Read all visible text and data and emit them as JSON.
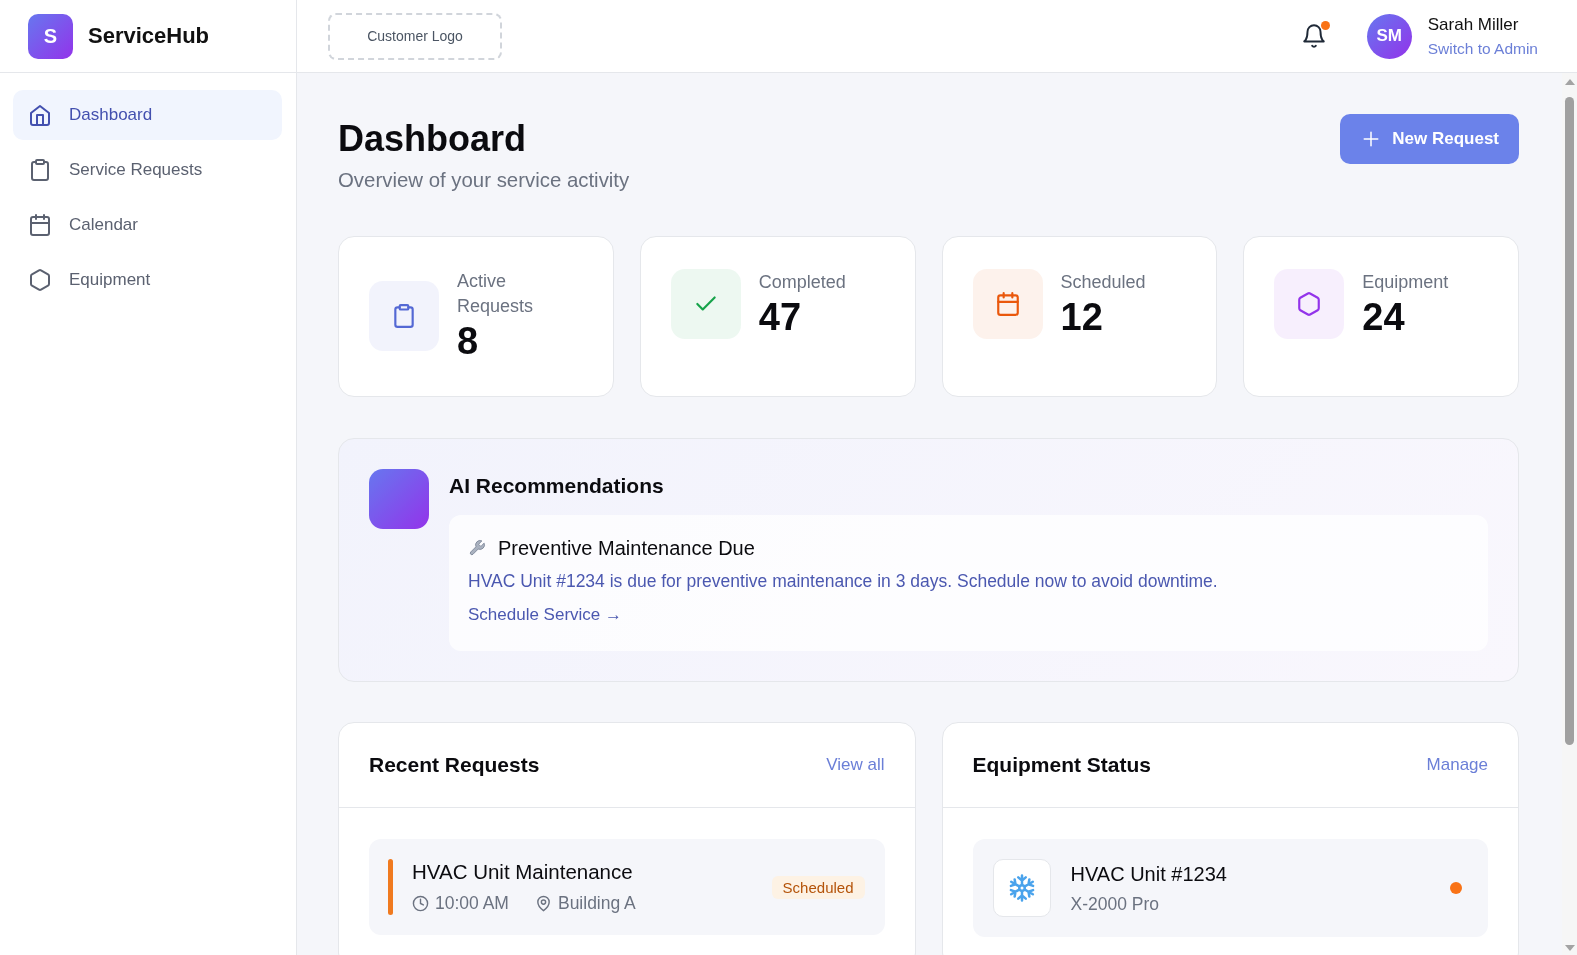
{
  "header": {
    "brand": {
      "initial": "S",
      "name": "ServiceHub"
    },
    "customer_logo": "Customer Logo",
    "notifications": {
      "unread": true
    },
    "user": {
      "initials": "SM",
      "name": "Sarah Miller",
      "link": "Switch to Admin"
    }
  },
  "sidebar": {
    "items": [
      {
        "label": "Dashboard",
        "kind": "dashboard",
        "selected": true
      },
      {
        "label": "Service Requests",
        "kind": "requests",
        "selected": false
      },
      {
        "label": "Calendar",
        "kind": "calendar",
        "selected": false
      },
      {
        "label": "Equipment",
        "kind": "equipment",
        "selected": false
      }
    ]
  },
  "page": {
    "title": "Dashboard",
    "subtitle": "Overview of your service activity",
    "action": "New Request"
  },
  "stats": [
    {
      "label": "Active Requests",
      "value": "8",
      "kind": "active",
      "color": "#5468d4"
    },
    {
      "label": "Completed",
      "value": "47",
      "kind": "completed",
      "color": "#16a34a"
    },
    {
      "label": "Scheduled",
      "value": "12",
      "kind": "scheduled",
      "color": "#ea580c"
    },
    {
      "label": "Equipment",
      "value": "24",
      "kind": "equipment",
      "color": "#9333ea"
    }
  ],
  "ai_recommendations": {
    "title": "AI Recommendations",
    "items": [
      {
        "title": "Preventive Maintenance Due",
        "text": "HVAC Unit #1234 is due for preventive maintenance in 3 days. Schedule now to avoid downtime.",
        "link": "Schedule Service →"
      }
    ]
  },
  "recent_requests": {
    "title": "Recent Requests",
    "link": "View all",
    "items": [
      {
        "title": "HVAC Unit Maintenance",
        "time": "10:00 AM",
        "location": "Building A",
        "status": "Scheduled",
        "kind": "scheduled"
      }
    ]
  },
  "equipment_status": {
    "title": "Equipment Status",
    "link": "Manage",
    "items": [
      {
        "name": "HVAC Unit #1234",
        "model": "X-2000 Pro",
        "color": "#f97316"
      }
    ]
  }
}
